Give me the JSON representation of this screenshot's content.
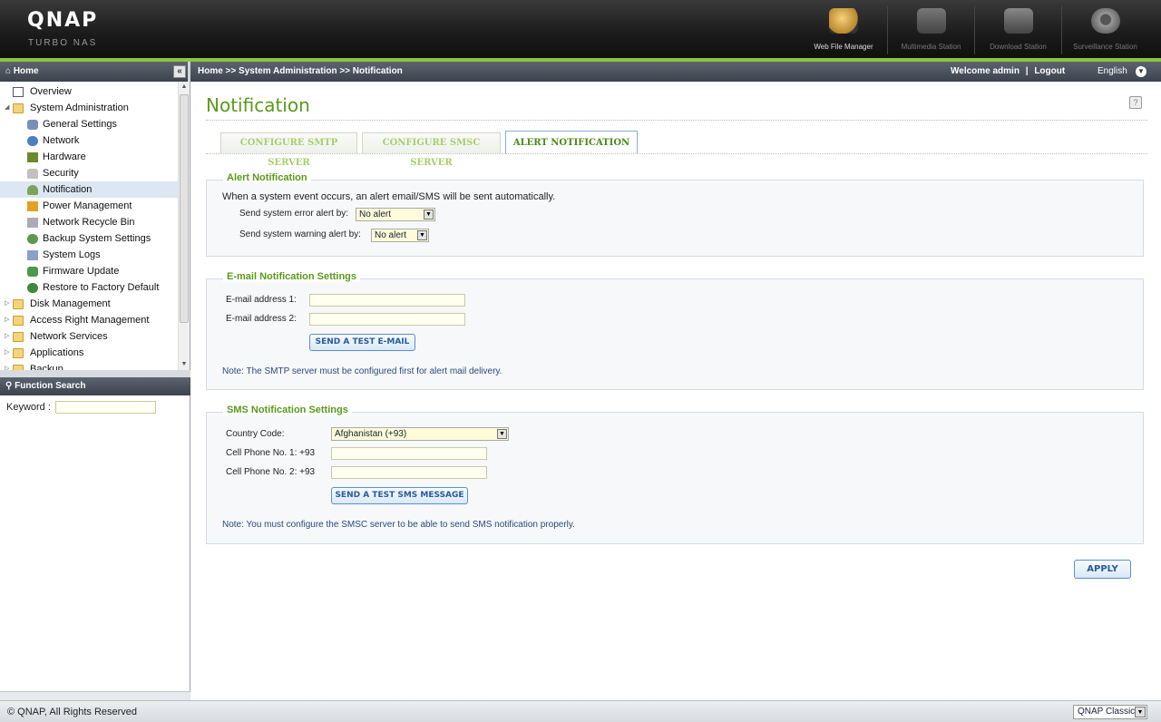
{
  "header": {
    "brand": "QNAP",
    "brand_sub": "TURBO NAS",
    "shortcuts": [
      {
        "label": "Web File Manager",
        "icon": "web-file-manager-icon"
      },
      {
        "label": "Multimedia Station",
        "icon": "multimedia-station-icon"
      },
      {
        "label": "Download Station",
        "icon": "download-station-icon"
      },
      {
        "label": "Surveillance Station",
        "icon": "surveillance-station-icon"
      }
    ]
  },
  "navbar": {
    "home": "Home",
    "breadcrumb": "Home >> System Administration >> Notification",
    "welcome": "Welcome admin",
    "separator": "|",
    "logout": "Logout",
    "language": "English"
  },
  "sidebar": {
    "tree": [
      {
        "label": "Overview",
        "icon": "overview-icon"
      },
      {
        "label": "System Administration",
        "icon": "folder-open-icon"
      },
      {
        "label": "General Settings",
        "icon": "general-settings-icon"
      },
      {
        "label": "Network",
        "icon": "network-icon"
      },
      {
        "label": "Hardware",
        "icon": "hardware-icon"
      },
      {
        "label": "Security",
        "icon": "security-icon"
      },
      {
        "label": "Notification",
        "icon": "notification-icon"
      },
      {
        "label": "Power Management",
        "icon": "power-icon"
      },
      {
        "label": "Network Recycle Bin",
        "icon": "recycle-bin-icon"
      },
      {
        "label": "Backup System Settings",
        "icon": "backup-icon"
      },
      {
        "label": "System Logs",
        "icon": "logs-icon"
      },
      {
        "label": "Firmware Update",
        "icon": "firmware-icon"
      },
      {
        "label": "Restore to Factory Default",
        "icon": "restore-icon"
      },
      {
        "label": "Disk Management",
        "icon": "folder-icon"
      },
      {
        "label": "Access Right Management",
        "icon": "folder-icon"
      },
      {
        "label": "Network Services",
        "icon": "folder-icon"
      },
      {
        "label": "Applications",
        "icon": "folder-icon"
      },
      {
        "label": "Backup",
        "icon": "folder-icon"
      }
    ],
    "function_search": {
      "title": "Function Search",
      "keyword_label": "Keyword :",
      "keyword_value": ""
    }
  },
  "main": {
    "title": "Notification",
    "tabs": [
      {
        "label": "CONFIGURE SMTP SERVER",
        "active": false
      },
      {
        "label": "CONFIGURE SMSC SERVER",
        "active": false
      },
      {
        "label": "ALERT NOTIFICATION",
        "active": true
      }
    ],
    "alert": {
      "legend": "Alert Notification",
      "description": "When a system event occurs, an alert email/SMS will be sent automatically.",
      "error_label": "Send system error alert by:",
      "error_value": "No alert",
      "warning_label": "Send system warning alert by:",
      "warning_value": "No alert"
    },
    "email": {
      "legend": "E-mail Notification Settings",
      "address1_label": "E-mail address 1:",
      "address1_value": "",
      "address2_label": "E-mail address 2:",
      "address2_value": "",
      "test_button": "SEND A TEST E-MAIL",
      "note": "Note: The SMTP server must be configured first for alert mail delivery."
    },
    "sms": {
      "legend": "SMS Notification Settings",
      "country_label": "Country Code:",
      "country_value": "Afghanistan (+93)",
      "phone1_label": "Cell Phone No. 1: +93",
      "phone1_value": "",
      "phone2_label": "Cell Phone No. 2: +93",
      "phone2_value": "",
      "test_button": "SEND A TEST SMS MESSAGE",
      "note": "Note: You must configure the SMSC server to be able to send SMS notification properly."
    },
    "apply_button": "APPLY"
  },
  "footer": {
    "copyright": "© QNAP, All Rights Reserved",
    "theme": "QNAP Classic"
  },
  "colors": {
    "accent_green": "#5a9a1a",
    "header_bar": "#1a1a1a",
    "nav_bar": "#4a525c",
    "link_blue": "#2a5a9a"
  }
}
